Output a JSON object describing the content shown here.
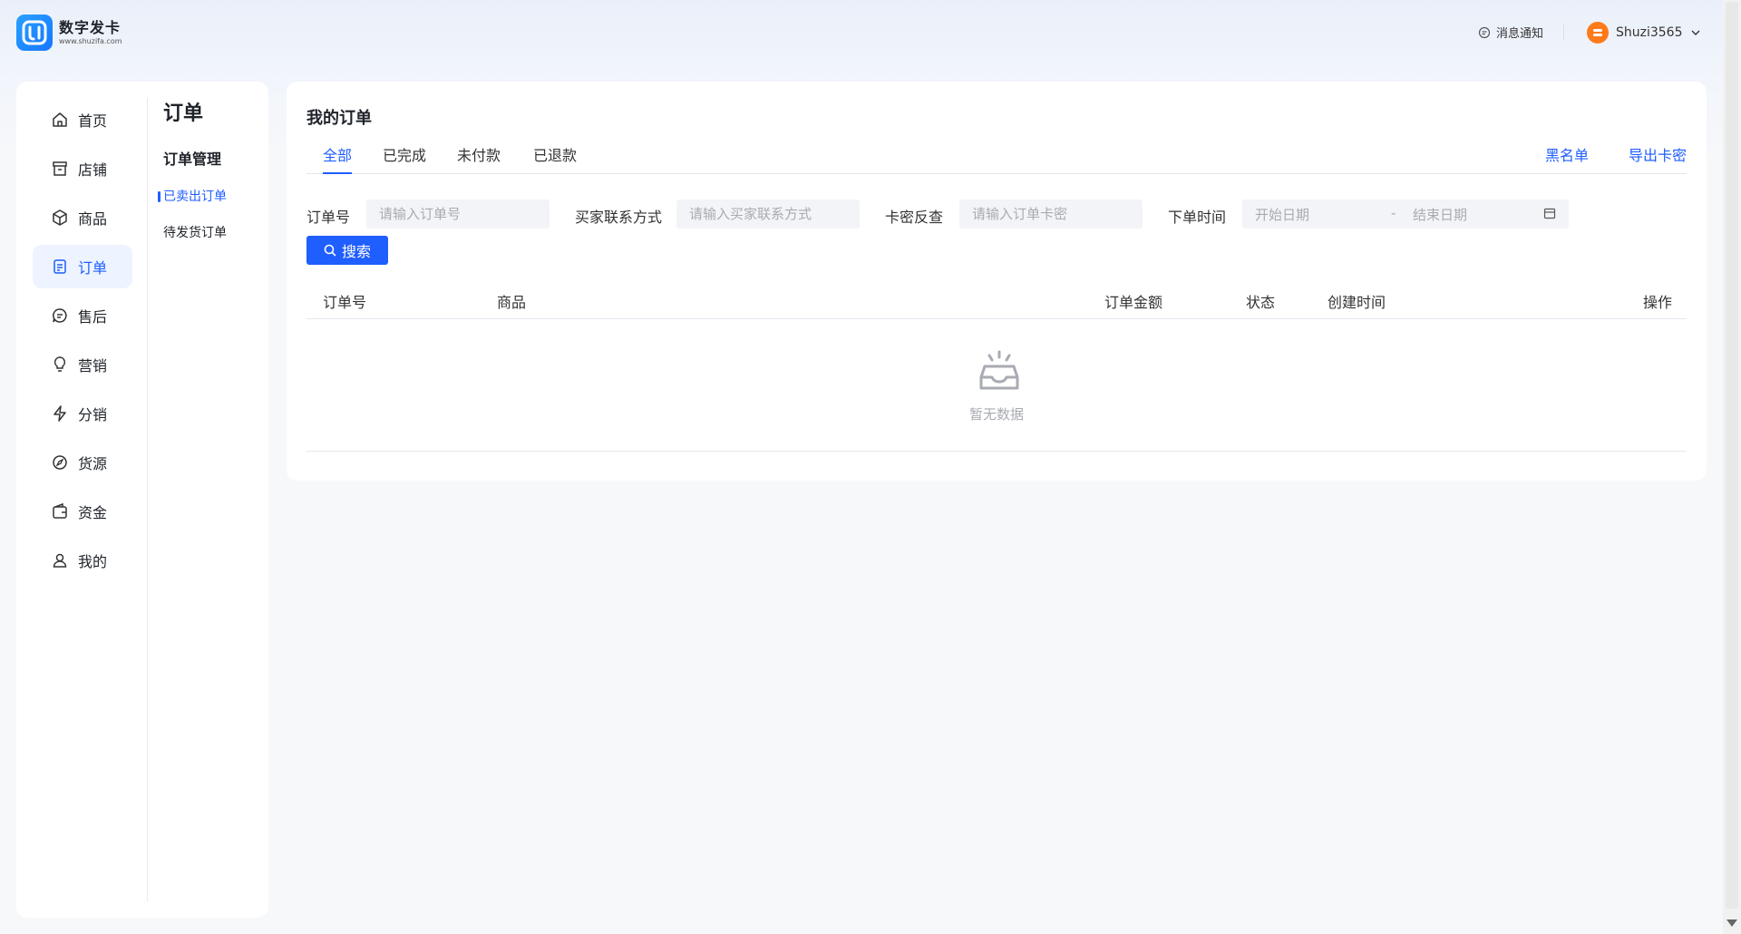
{
  "brand": {
    "name": "数字发卡",
    "url": "www.shuzifa.com"
  },
  "header": {
    "notify_label": "消息通知",
    "username": "Shuzi3565"
  },
  "nav": {
    "items": [
      {
        "label": "首页",
        "icon": "home-icon"
      },
      {
        "label": "店铺",
        "icon": "store-icon"
      },
      {
        "label": "商品",
        "icon": "box-icon"
      },
      {
        "label": "订单",
        "icon": "order-doc-icon",
        "active": true
      },
      {
        "label": "售后",
        "icon": "chat-icon"
      },
      {
        "label": "营销",
        "icon": "bulb-icon"
      },
      {
        "label": "分销",
        "icon": "bolt-icon"
      },
      {
        "label": "货源",
        "icon": "compass-icon"
      },
      {
        "label": "资金",
        "icon": "wallet-icon"
      },
      {
        "label": "我的",
        "icon": "user-icon"
      }
    ]
  },
  "subnav": {
    "title": "订单",
    "group": "订单管理",
    "items": [
      {
        "label": "已卖出订单",
        "active": true
      },
      {
        "label": "待发货订单",
        "active": false
      }
    ]
  },
  "main": {
    "title": "我的订单",
    "tabs": [
      "全部",
      "已完成",
      "未付款",
      "已退款"
    ],
    "active_tab": "全部",
    "links": {
      "blacklist": "黑名单",
      "export": "导出卡密"
    },
    "filters": {
      "order_no": {
        "label": "订单号",
        "placeholder": "请输入订单号"
      },
      "contact": {
        "label": "买家联系方式",
        "placeholder": "请输入买家联系方式"
      },
      "card": {
        "label": "卡密反查",
        "placeholder": "请输入订单卡密"
      },
      "time": {
        "label": "下单时间",
        "start": "开始日期",
        "sep": "-",
        "end": "结束日期"
      }
    },
    "search_label": "搜索",
    "columns": [
      "订单号",
      "商品",
      "订单金额",
      "状态",
      "创建时间",
      "操作"
    ],
    "empty_text": "暂无数据"
  },
  "colors": {
    "accent": "#1f5eff",
    "avatar": "#ff7a1a"
  }
}
